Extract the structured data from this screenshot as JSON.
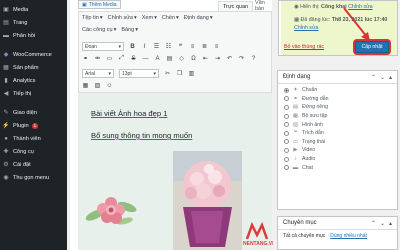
{
  "sidebar": {
    "items": [
      {
        "label": "Media",
        "icon": "media-icon"
      },
      {
        "label": "Trang",
        "icon": "page-icon"
      },
      {
        "label": "Phản hồi",
        "icon": "comment-icon"
      },
      {
        "label": "WooCommerce",
        "icon": "woocommerce-icon"
      },
      {
        "label": "Sản phẩm",
        "icon": "product-icon"
      },
      {
        "label": "Analytics",
        "icon": "analytics-icon"
      },
      {
        "label": "Tiếp thị",
        "icon": "marketing-icon"
      },
      {
        "label": "Giao diện",
        "icon": "appearance-icon"
      },
      {
        "label": "Plugin",
        "icon": "plugin-icon",
        "badge": "1"
      },
      {
        "label": "Thành viên",
        "icon": "users-icon"
      },
      {
        "label": "Công cụ",
        "icon": "tools-icon"
      },
      {
        "label": "Cài đặt",
        "icon": "settings-icon"
      },
      {
        "label": "Thu gọn menu",
        "icon": "collapse-icon"
      }
    ]
  },
  "editor": {
    "add_media": "Thêm Media",
    "tabs": {
      "visual": "Trực quan",
      "text": "Văn bản"
    },
    "toolbar": {
      "row1": [
        "Tệp tin",
        "Chỉnh sửa",
        "Xem",
        "Chèn",
        "Định dạng"
      ],
      "row2": [
        "Các công cụ",
        "Bảng"
      ],
      "paragraph": "Đoạn",
      "font": "Arial",
      "size": "13pt"
    },
    "content": {
      "line1": "Bài viết Ảnh hoa đẹp 1",
      "line2": "Bổ sung thông tin mong muốn"
    }
  },
  "publish": {
    "visibility_prefix": "Hiển thị: ",
    "visibility_value": "Công khai",
    "visibility_link": "Chỉnh sửa",
    "published_prefix": "Đã đăng lúc: ",
    "published_value": "Th8 23, 2021 lúc 17:40",
    "published_link": "Chỉnh sửa",
    "trash_link": "Bỏ vào thùng rác",
    "update_button": "Cập nhật"
  },
  "format_panel": {
    "title": "Định dạng",
    "options": [
      {
        "label": "Chuẩn",
        "icon": "pin-icon",
        "selected": true
      },
      {
        "label": "Đường dẫn",
        "icon": "link-icon",
        "selected": false
      },
      {
        "label": "Đứng riêng",
        "icon": "aside-icon",
        "selected": false
      },
      {
        "label": "Bộ sưu tập",
        "icon": "gallery-icon",
        "selected": false
      },
      {
        "label": "Hình ảnh",
        "icon": "image-icon",
        "selected": false
      },
      {
        "label": "Trích dẫn",
        "icon": "quote-icon",
        "selected": false
      },
      {
        "label": "Trạng thái",
        "icon": "status-icon",
        "selected": false
      },
      {
        "label": "Video",
        "icon": "video-icon",
        "selected": false
      },
      {
        "label": "Audio",
        "icon": "audio-icon",
        "selected": false
      },
      {
        "label": "Chat",
        "icon": "chat-icon",
        "selected": false
      }
    ]
  },
  "category_panel": {
    "title": "Chuyên mục",
    "tab_all": "Tất cả chuyên mục",
    "tab_popular": "Dùng nhiều nhất"
  },
  "watermark": "NENTANG.VN",
  "colors": {
    "sidebar_bg": "#1d2327",
    "accent": "#2271b1",
    "highlight": "#eef6cc",
    "annotation_red": "#d63638"
  }
}
